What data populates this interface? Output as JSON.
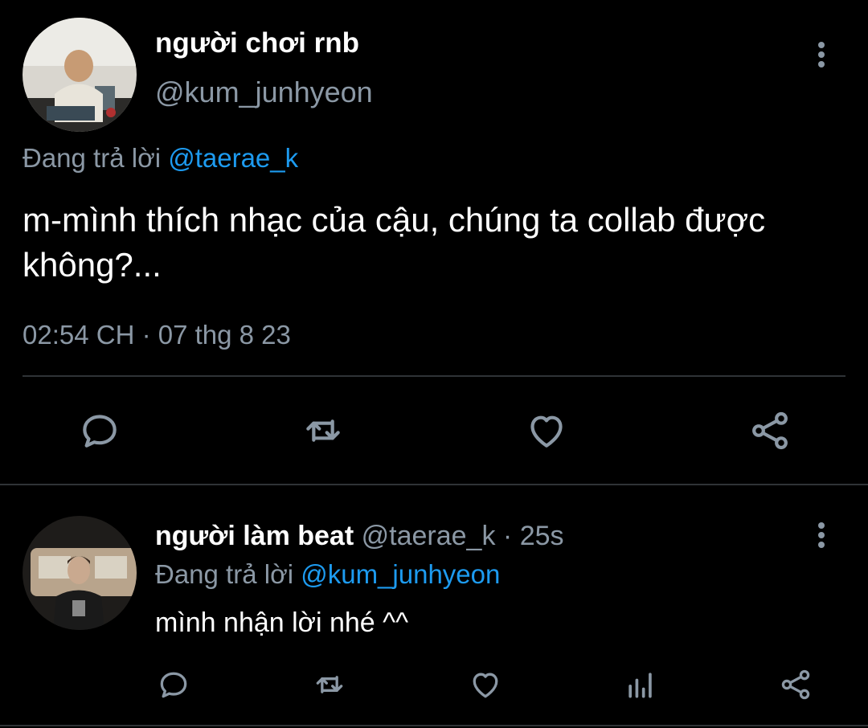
{
  "main_tweet": {
    "display_name": "người chơi rnb",
    "handle": "@kum_junhyeon",
    "replying_prefix": "Đang trả lời",
    "replying_to": "@taerae_k",
    "text": "m-mình thích nhạc của cậu, chúng ta collab được không?...",
    "timestamp": "02:54 CH · 07 thg 8 23",
    "actions": [
      "reply-icon",
      "retweet-icon",
      "like-icon",
      "share-icon"
    ],
    "more_icon": "more-vertical-icon"
  },
  "reply_tweet": {
    "display_name": "người làm beat",
    "handle": "@taerae_k",
    "separator": "·",
    "time_ago": "25s",
    "replying_prefix": "Đang trả lời",
    "replying_to": "@kum_junhyeon",
    "text": "mình nhận lời nhé ^^",
    "actions": [
      "reply-icon",
      "retweet-icon",
      "like-icon",
      "views-icon",
      "share-icon"
    ],
    "more_icon": "more-vertical-icon"
  },
  "colors": {
    "background": "#000000",
    "primary_text": "#ffffff",
    "secondary_text": "#8b98a5",
    "mention": "#1d9bf0",
    "divider": "#2f3336"
  }
}
